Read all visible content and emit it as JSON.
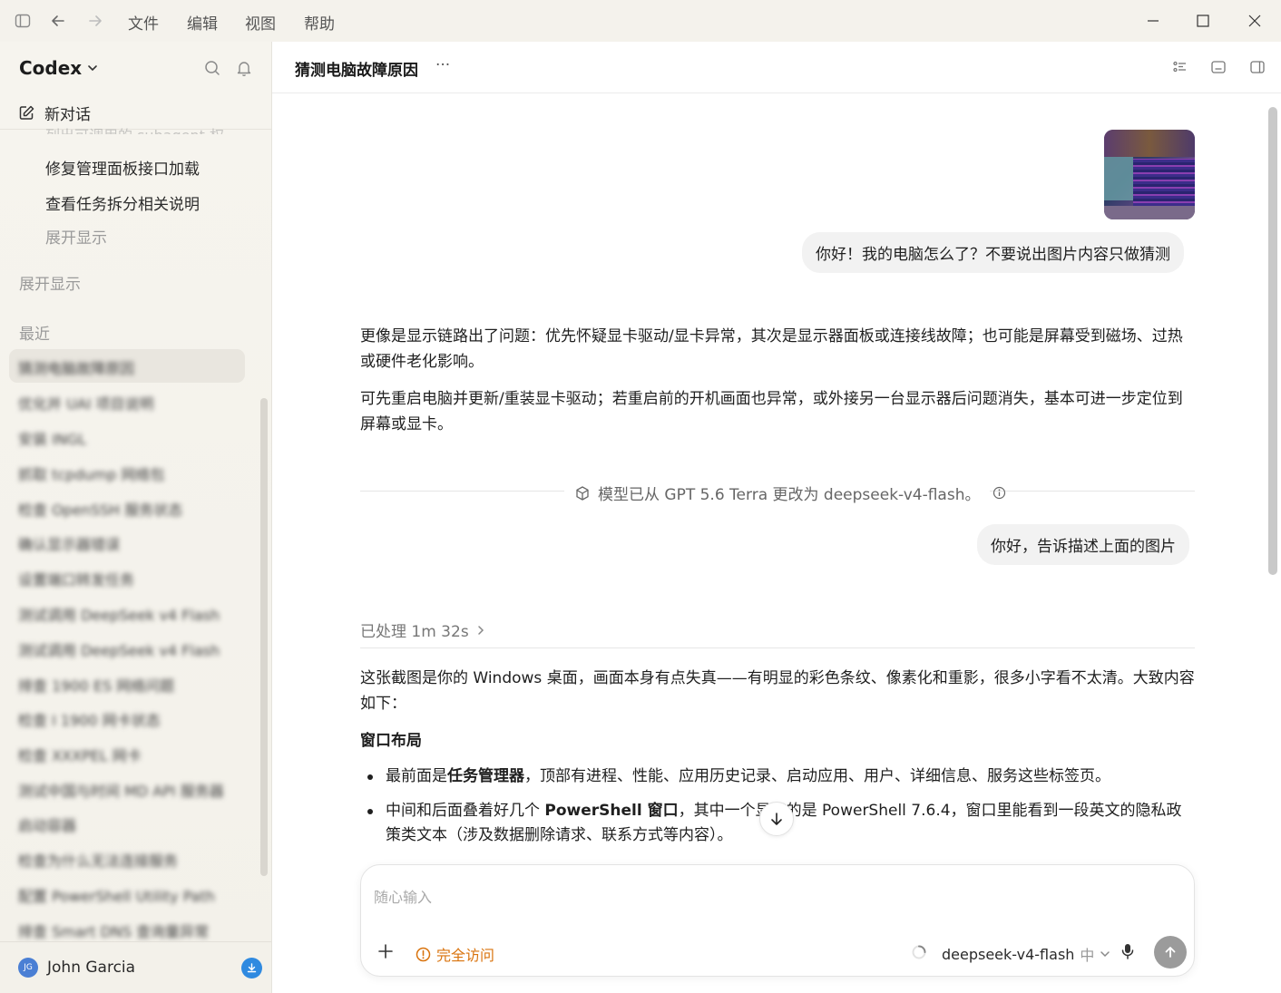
{
  "window": {
    "menu": [
      "文件",
      "编辑",
      "视图",
      "帮助"
    ]
  },
  "sidebar": {
    "brand": "Codex",
    "new_chat": "新对话",
    "partial_item": "列出可调用的 subagent 权...",
    "items": [
      "修复管理面板接口加载",
      "查看任务拆分相关说明"
    ],
    "expand_inner": "展开显示",
    "expand_outer": "展开显示",
    "recent_label": "最近",
    "recent_items": [
      "猜测电脑故障原因",
      "优化并 UAI 项目说明",
      "安装 INGL",
      "抓取 tcpdump 网络包",
      "检查 OpenSSH 服务状态",
      "确认显示器错误",
      "设置端口转发任务",
      "测试调用 DeepSeek v4 Flash",
      "测试调用 DeepSeek v4 Flash",
      "排查 1900 ES 网络问题",
      "检查 I 1900 网卡状态",
      "检查 XXXPEL 网卡",
      "测试中国与时间 MD API 服务器",
      "启动容器",
      "检查为什么无法连接服务",
      "配置 PowerShell Utility Path",
      "排查 Smart DNS 查询量异常"
    ],
    "user_initials": "JG",
    "user_name": "John Garcia"
  },
  "header": {
    "title": "猜测电脑故障原因",
    "more": "···"
  },
  "chat": {
    "user_msg_1": "你好！我的电脑怎么了？不要说出图片内容只做猜测",
    "reply_1_p1": "更像是显示链路出了问题：优先怀疑显卡驱动/显卡异常，其次是显示器面板或连接线故障；也可能是屏幕受到磁场、过热或硬件老化影响。",
    "reply_1_p2": "可先重启电脑并更新/重装显卡驱动；若重启前的开机画面也异常，或外接另一台显示器后问题消失，基本可进一步定位到屏幕或显卡。",
    "model_change": "模型已从 GPT 5.6 Terra 更改为 deepseek-v4-flash。",
    "user_msg_2": "你好，告诉描述上面的图片",
    "processed": "已处理 1m 32s",
    "reply_2_intro": "这张截图是你的 Windows 桌面，画面本身有点失真——有明显的彩色条纹、像素化和重影，很多小字看不太清。大致内容如下：",
    "section_title": "窗口布局",
    "bullet_1_pre": "最前面是",
    "bullet_1_bold": "任务管理器",
    "bullet_1_post": "，顶部有进程、性能、应用历史记录、启动应用、用户、详细信息、服务这些标签页。",
    "bullet_2_pre": "中间和后面叠着好几个 ",
    "bullet_2_bold": "PowerShell 窗口",
    "bullet_2_post": "，其中一个显示的是 PowerShell 7.6.4，窗口里能看到一段英文的隐私政策类文本（涉及数据删除请求、联系方式等内容）。"
  },
  "composer": {
    "placeholder": "随心输入",
    "access": "完全访问",
    "model": "deepseek-v4-flash",
    "lang": "中"
  },
  "colors": {
    "accent_orange": "#d9730d",
    "avatar_blue": "#4a7fd4",
    "download_blue": "#2f8ae0"
  }
}
